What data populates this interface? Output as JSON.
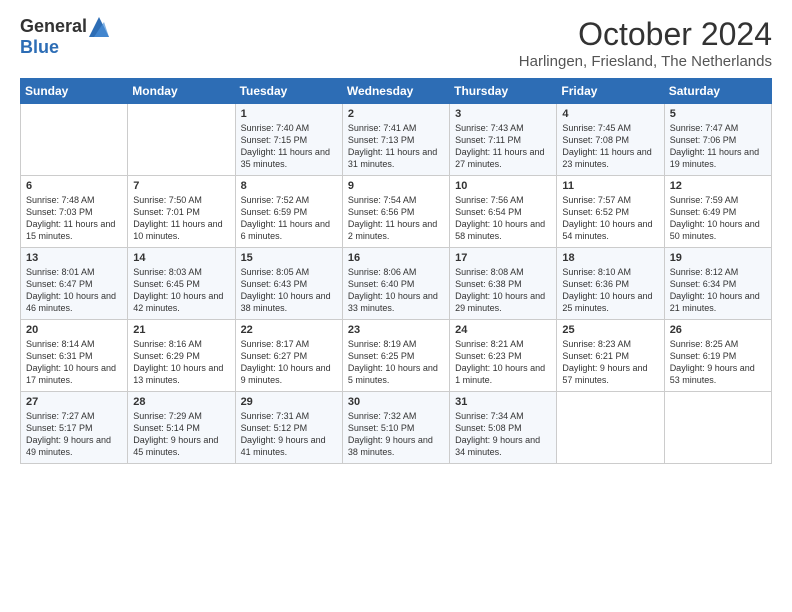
{
  "logo": {
    "general": "General",
    "blue": "Blue"
  },
  "title": "October 2024",
  "subtitle": "Harlingen, Friesland, The Netherlands",
  "days_of_week": [
    "Sunday",
    "Monday",
    "Tuesday",
    "Wednesday",
    "Thursday",
    "Friday",
    "Saturday"
  ],
  "weeks": [
    [
      {
        "day": "",
        "info": ""
      },
      {
        "day": "",
        "info": ""
      },
      {
        "day": "1",
        "info": "Sunrise: 7:40 AM\nSunset: 7:15 PM\nDaylight: 11 hours and 35 minutes."
      },
      {
        "day": "2",
        "info": "Sunrise: 7:41 AM\nSunset: 7:13 PM\nDaylight: 11 hours and 31 minutes."
      },
      {
        "day": "3",
        "info": "Sunrise: 7:43 AM\nSunset: 7:11 PM\nDaylight: 11 hours and 27 minutes."
      },
      {
        "day": "4",
        "info": "Sunrise: 7:45 AM\nSunset: 7:08 PM\nDaylight: 11 hours and 23 minutes."
      },
      {
        "day": "5",
        "info": "Sunrise: 7:47 AM\nSunset: 7:06 PM\nDaylight: 11 hours and 19 minutes."
      }
    ],
    [
      {
        "day": "6",
        "info": "Sunrise: 7:48 AM\nSunset: 7:03 PM\nDaylight: 11 hours and 15 minutes."
      },
      {
        "day": "7",
        "info": "Sunrise: 7:50 AM\nSunset: 7:01 PM\nDaylight: 11 hours and 10 minutes."
      },
      {
        "day": "8",
        "info": "Sunrise: 7:52 AM\nSunset: 6:59 PM\nDaylight: 11 hours and 6 minutes."
      },
      {
        "day": "9",
        "info": "Sunrise: 7:54 AM\nSunset: 6:56 PM\nDaylight: 11 hours and 2 minutes."
      },
      {
        "day": "10",
        "info": "Sunrise: 7:56 AM\nSunset: 6:54 PM\nDaylight: 10 hours and 58 minutes."
      },
      {
        "day": "11",
        "info": "Sunrise: 7:57 AM\nSunset: 6:52 PM\nDaylight: 10 hours and 54 minutes."
      },
      {
        "day": "12",
        "info": "Sunrise: 7:59 AM\nSunset: 6:49 PM\nDaylight: 10 hours and 50 minutes."
      }
    ],
    [
      {
        "day": "13",
        "info": "Sunrise: 8:01 AM\nSunset: 6:47 PM\nDaylight: 10 hours and 46 minutes."
      },
      {
        "day": "14",
        "info": "Sunrise: 8:03 AM\nSunset: 6:45 PM\nDaylight: 10 hours and 42 minutes."
      },
      {
        "day": "15",
        "info": "Sunrise: 8:05 AM\nSunset: 6:43 PM\nDaylight: 10 hours and 38 minutes."
      },
      {
        "day": "16",
        "info": "Sunrise: 8:06 AM\nSunset: 6:40 PM\nDaylight: 10 hours and 33 minutes."
      },
      {
        "day": "17",
        "info": "Sunrise: 8:08 AM\nSunset: 6:38 PM\nDaylight: 10 hours and 29 minutes."
      },
      {
        "day": "18",
        "info": "Sunrise: 8:10 AM\nSunset: 6:36 PM\nDaylight: 10 hours and 25 minutes."
      },
      {
        "day": "19",
        "info": "Sunrise: 8:12 AM\nSunset: 6:34 PM\nDaylight: 10 hours and 21 minutes."
      }
    ],
    [
      {
        "day": "20",
        "info": "Sunrise: 8:14 AM\nSunset: 6:31 PM\nDaylight: 10 hours and 17 minutes."
      },
      {
        "day": "21",
        "info": "Sunrise: 8:16 AM\nSunset: 6:29 PM\nDaylight: 10 hours and 13 minutes."
      },
      {
        "day": "22",
        "info": "Sunrise: 8:17 AM\nSunset: 6:27 PM\nDaylight: 10 hours and 9 minutes."
      },
      {
        "day": "23",
        "info": "Sunrise: 8:19 AM\nSunset: 6:25 PM\nDaylight: 10 hours and 5 minutes."
      },
      {
        "day": "24",
        "info": "Sunrise: 8:21 AM\nSunset: 6:23 PM\nDaylight: 10 hours and 1 minute."
      },
      {
        "day": "25",
        "info": "Sunrise: 8:23 AM\nSunset: 6:21 PM\nDaylight: 9 hours and 57 minutes."
      },
      {
        "day": "26",
        "info": "Sunrise: 8:25 AM\nSunset: 6:19 PM\nDaylight: 9 hours and 53 minutes."
      }
    ],
    [
      {
        "day": "27",
        "info": "Sunrise: 7:27 AM\nSunset: 5:17 PM\nDaylight: 9 hours and 49 minutes."
      },
      {
        "day": "28",
        "info": "Sunrise: 7:29 AM\nSunset: 5:14 PM\nDaylight: 9 hours and 45 minutes."
      },
      {
        "day": "29",
        "info": "Sunrise: 7:31 AM\nSunset: 5:12 PM\nDaylight: 9 hours and 41 minutes."
      },
      {
        "day": "30",
        "info": "Sunrise: 7:32 AM\nSunset: 5:10 PM\nDaylight: 9 hours and 38 minutes."
      },
      {
        "day": "31",
        "info": "Sunrise: 7:34 AM\nSunset: 5:08 PM\nDaylight: 9 hours and 34 minutes."
      },
      {
        "day": "",
        "info": ""
      },
      {
        "day": "",
        "info": ""
      }
    ]
  ]
}
